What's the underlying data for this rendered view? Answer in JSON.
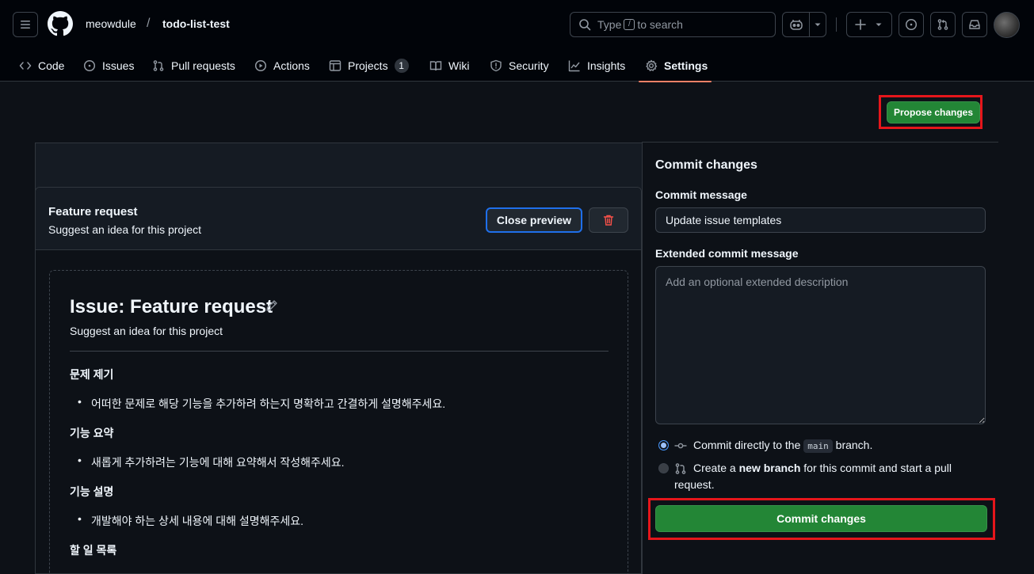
{
  "repo": {
    "owner": "meowdule",
    "separator": "/",
    "name": "todo-list-test"
  },
  "search": {
    "pre": "Type",
    "key": "/",
    "post": "to search"
  },
  "tabs": [
    {
      "label": "Code"
    },
    {
      "label": "Issues"
    },
    {
      "label": "Pull requests"
    },
    {
      "label": "Actions"
    },
    {
      "label": "Projects",
      "count": "1"
    },
    {
      "label": "Wiki"
    },
    {
      "label": "Security"
    },
    {
      "label": "Insights"
    },
    {
      "label": "Settings"
    }
  ],
  "propose_label": "Propose changes",
  "card": {
    "title": "Feature request",
    "subtitle": "Suggest an idea for this project",
    "close_preview": "Close preview"
  },
  "preview": {
    "title": "Issue: Feature request",
    "subtitle": "Suggest an idea for this project",
    "sections": [
      {
        "heading": "문제 제기",
        "item": "어떠한 문제로 해당 기능을 추가하려 하는지 명확하고 간결하게 설명해주세요."
      },
      {
        "heading": "기능 요약",
        "item": "새롭게 추가하려는 기능에 대해 요약해서 작성해주세요."
      },
      {
        "heading": "기능 설명",
        "item": "개발해야 하는 상세 내용에 대해 설명해주세요."
      },
      {
        "heading": "할 일 목록"
      }
    ]
  },
  "commit": {
    "title": "Commit changes",
    "message_label": "Commit message",
    "message_value": "Update issue templates",
    "extended_label": "Extended commit message",
    "extended_placeholder": "Add an optional extended description",
    "opt1_pre": "Commit directly to the",
    "opt1_branch": "main",
    "opt1_post": "branch.",
    "opt2_pre": "Create a",
    "opt2_bold": "new branch",
    "opt2_post": "for this commit and start a pull",
    "opt2_line2": "request.",
    "button": "Commit changes"
  },
  "colors": {
    "accent": "#238636",
    "highlight": "#e5161b",
    "underline": "#f78166"
  }
}
